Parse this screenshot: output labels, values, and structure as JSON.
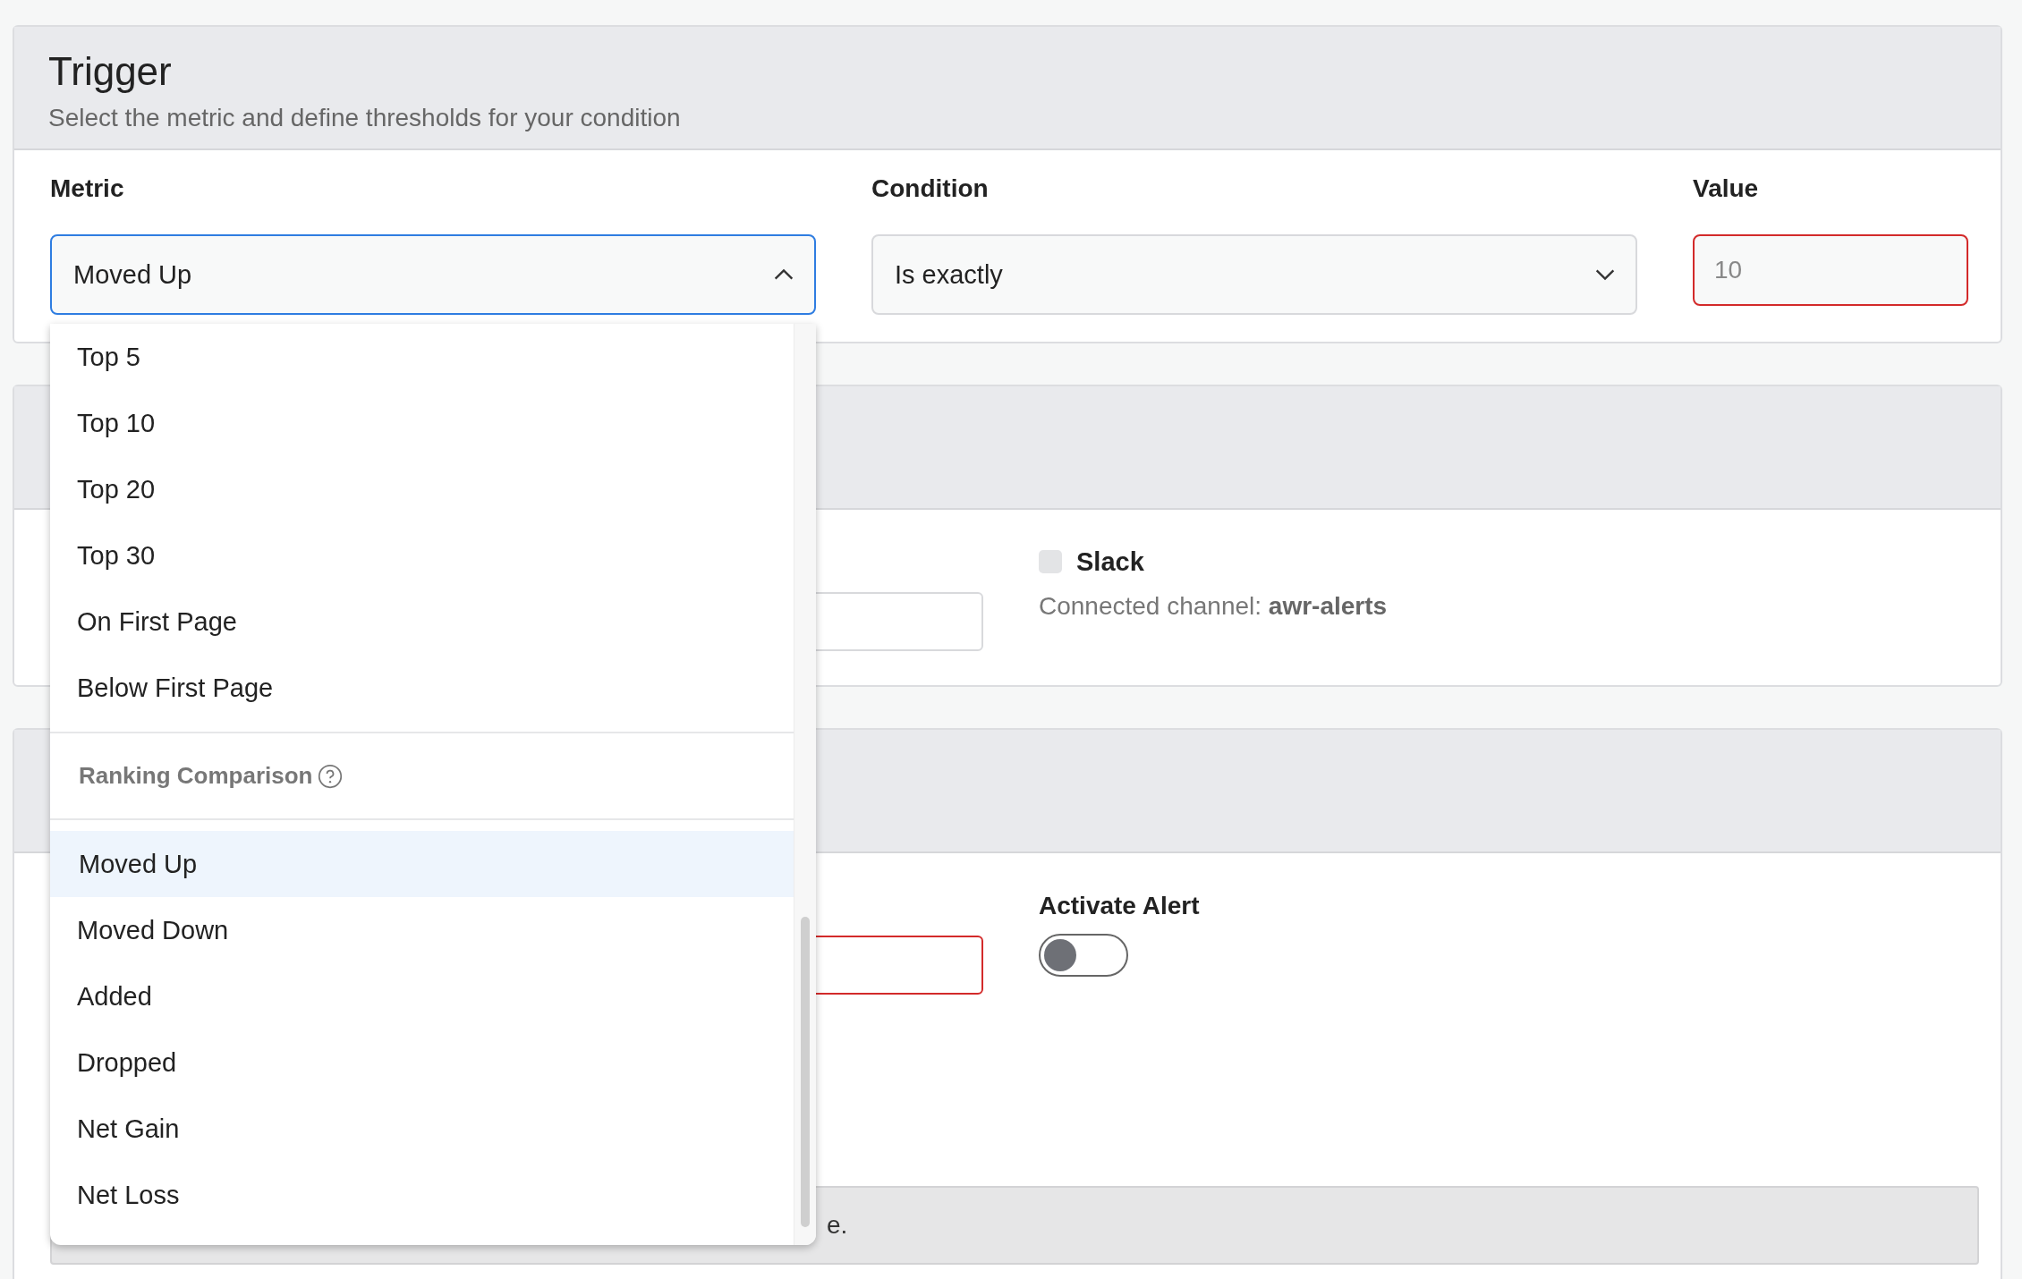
{
  "trigger": {
    "title": "Trigger",
    "subtitle": "Select the metric and define thresholds for your condition",
    "metric": {
      "label": "Metric",
      "value": "Moved Up",
      "focused": true,
      "expanded": true
    },
    "condition": {
      "label": "Condition",
      "value": "Is exactly"
    },
    "value": {
      "label": "Value",
      "placeholder": "10",
      "invalid": true
    }
  },
  "metric_dropdown": {
    "groups": [
      {
        "items": [
          {
            "label": "Top 5",
            "selected": false
          },
          {
            "label": "Top 10",
            "selected": false
          },
          {
            "label": "Top 20",
            "selected": false
          },
          {
            "label": "Top 30",
            "selected": false
          },
          {
            "label": "On First Page",
            "selected": false
          },
          {
            "label": "Below First Page",
            "selected": false
          }
        ]
      },
      {
        "heading": "Ranking Comparison",
        "items": [
          {
            "label": "Moved Up",
            "selected": true
          },
          {
            "label": "Moved Down",
            "selected": false
          },
          {
            "label": "Added",
            "selected": false
          },
          {
            "label": "Dropped",
            "selected": false
          },
          {
            "label": "Net Gain",
            "selected": false
          },
          {
            "label": "Net Loss",
            "selected": false
          }
        ]
      }
    ]
  },
  "notifications": {
    "field": {
      "invalid": false
    },
    "slack": {
      "label": "Slack",
      "checked": false,
      "channel_text": "Connected channel: **awr-alerts**"
    }
  },
  "activation": {
    "field": {
      "invalid": true
    },
    "activate": {
      "label": "Activate Alert",
      "on": false
    }
  },
  "bottom_bar": {
    "text": "e."
  }
}
